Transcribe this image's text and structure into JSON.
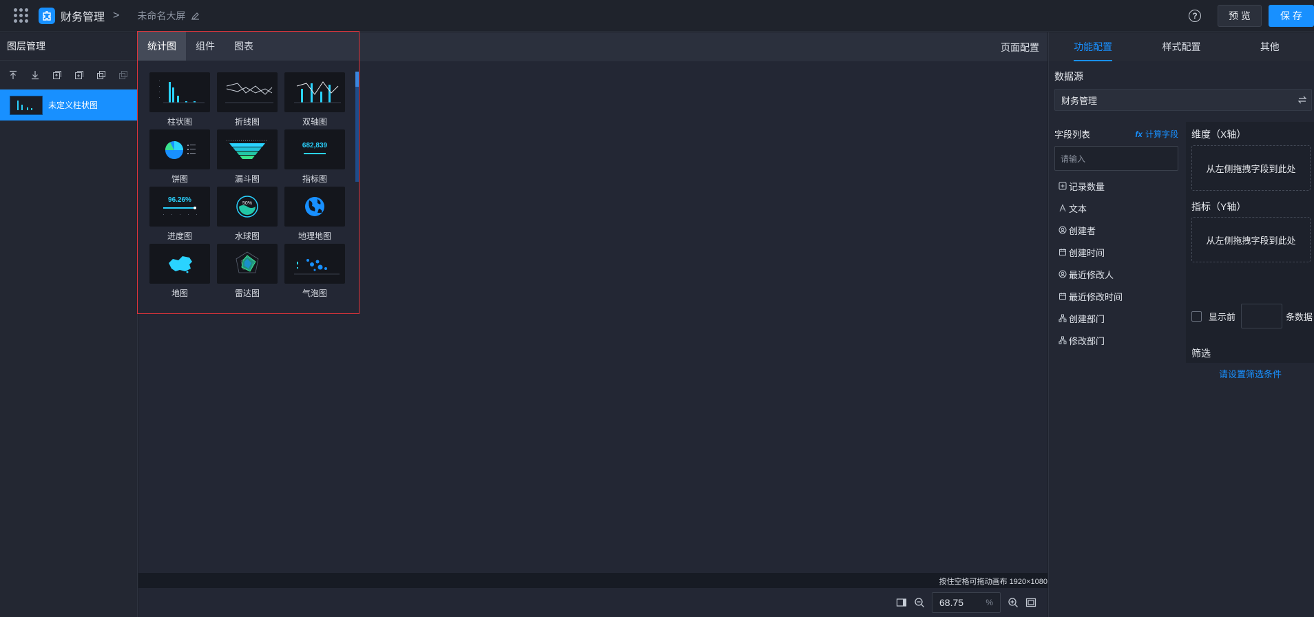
{
  "header": {
    "app_title": "财务管理",
    "screen_name": "未命名大屏",
    "preview_label": "预 览",
    "save_label": "保 存",
    "help_glyph": "?"
  },
  "layers": {
    "title": "图层管理",
    "items": [
      {
        "label": "未定义柱状图"
      }
    ]
  },
  "canvas": {
    "page_config_label": "页面配置",
    "hint": "按住空格可拖动画布 1920×1080",
    "zoom_value": "68.75",
    "zoom_unit": "%"
  },
  "picker": {
    "tabs": [
      {
        "label": "统计图",
        "active": true
      },
      {
        "label": "组件",
        "active": false
      },
      {
        "label": "图表",
        "active": false
      }
    ],
    "charts": [
      {
        "label": "柱状图",
        "icon": "bar-chart-icon"
      },
      {
        "label": "折线图",
        "icon": "line-chart-icon"
      },
      {
        "label": "双轴图",
        "icon": "dual-axis-chart-icon"
      },
      {
        "label": "饼图",
        "icon": "pie-chart-icon"
      },
      {
        "label": "漏斗图",
        "icon": "funnel-chart-icon"
      },
      {
        "label": "指标图",
        "icon": "indicator-chart-icon",
        "thumb_text": "682,839"
      },
      {
        "label": "进度图",
        "icon": "progress-chart-icon",
        "thumb_text": "96.26%"
      },
      {
        "label": "水球图",
        "icon": "liquid-chart-icon",
        "thumb_text": "50%"
      },
      {
        "label": "地理地图",
        "icon": "globe-map-icon"
      },
      {
        "label": "地图",
        "icon": "china-map-icon"
      },
      {
        "label": "雷达图",
        "icon": "radar-chart-icon"
      },
      {
        "label": "气泡图",
        "icon": "bubble-chart-icon"
      }
    ]
  },
  "config": {
    "tabs": [
      {
        "label": "功能配置",
        "active": true
      },
      {
        "label": "样式配置",
        "active": false
      },
      {
        "label": "其他",
        "active": false
      }
    ],
    "datasource_title": "数据源",
    "datasource_value": "财务管理",
    "field_list_title": "字段列表",
    "calc_field_label": "计算字段",
    "calc_field_glyph": "fx",
    "search_placeholder": "请输入",
    "fields": [
      {
        "label": "记录数量",
        "icon": "count-icon"
      },
      {
        "label": "文本",
        "icon": "text-icon"
      },
      {
        "label": "创建者",
        "icon": "user-icon"
      },
      {
        "label": "创建时间",
        "icon": "calendar-icon"
      },
      {
        "label": "最近修改人",
        "icon": "user-icon"
      },
      {
        "label": "最近修改时间",
        "icon": "calendar-icon"
      },
      {
        "label": "创建部门",
        "icon": "org-icon"
      },
      {
        "label": "修改部门",
        "icon": "org-icon"
      }
    ],
    "dimension_title": "维度（X轴）",
    "dimension_drop": "从左侧拖拽字段到此处",
    "metric_title": "指标（Y轴）",
    "metric_drop": "从左侧拖拽字段到此处",
    "topn_prefix": "显示前",
    "topn_suffix": "条数据",
    "filter_title": "筛选",
    "filter_link": "请设置筛选条件"
  },
  "colors": {
    "accent": "#1890ff",
    "picker_border": "#e0343a",
    "chart_cyan": "#2ad3ff",
    "chart_green": "#3be28c"
  }
}
